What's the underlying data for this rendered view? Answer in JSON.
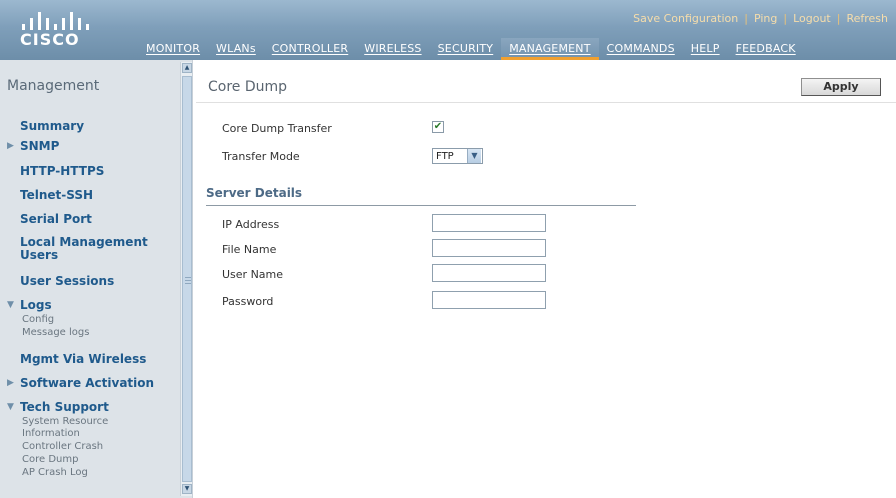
{
  "header": {
    "brand": "CISCO",
    "utility_links": [
      "Save Configuration",
      "Ping",
      "Logout",
      "Refresh"
    ],
    "nav": [
      "MONITOR",
      "WLANs",
      "CONTROLLER",
      "WIRELESS",
      "SECURITY",
      "MANAGEMENT",
      "COMMANDS",
      "HELP",
      "FEEDBACK"
    ],
    "active_nav": "MANAGEMENT"
  },
  "sidebar": {
    "title": "Management",
    "items": [
      {
        "label": "Summary"
      },
      {
        "label": "SNMP",
        "arrow": "▶"
      },
      {
        "label": "HTTP-HTTPS"
      },
      {
        "label": "Telnet-SSH"
      },
      {
        "label": "Serial Port"
      },
      {
        "label": "Local Management Users"
      },
      {
        "label": "User Sessions"
      },
      {
        "label": "Logs",
        "arrow": "▼",
        "subitems": [
          "Config",
          "Message logs"
        ]
      },
      {
        "label": "Mgmt Via Wireless"
      },
      {
        "label": "Software Activation",
        "arrow": "▶"
      },
      {
        "label": "Tech Support",
        "arrow": "▼",
        "subitems": [
          "System Resource Information",
          "Controller Crash",
          "Core Dump",
          "AP Crash Log"
        ]
      }
    ]
  },
  "main": {
    "title": "Core Dump",
    "apply_label": "Apply",
    "core_dump_transfer": {
      "label": "Core Dump Transfer",
      "checked": true,
      "check_glyph": "✔"
    },
    "transfer_mode": {
      "label": "Transfer Mode",
      "value": "FTP",
      "arrow": "▼"
    },
    "server_details": {
      "title": "Server Details",
      "fields": [
        {
          "label": "IP Address",
          "value": ""
        },
        {
          "label": "File Name",
          "value": ""
        },
        {
          "label": "User Name",
          "value": ""
        },
        {
          "label": "Password",
          "value": ""
        }
      ]
    }
  },
  "icons": {
    "scroll_up": "▲",
    "scroll_down": "▼"
  },
  "colors": {
    "header_gradient": "#7f9fba",
    "active_tab_underline": "#f0a030",
    "sidebar_bg": "#dde3e8",
    "sidebar_link": "#1f5a8c",
    "section_title": "#4d6a86"
  }
}
